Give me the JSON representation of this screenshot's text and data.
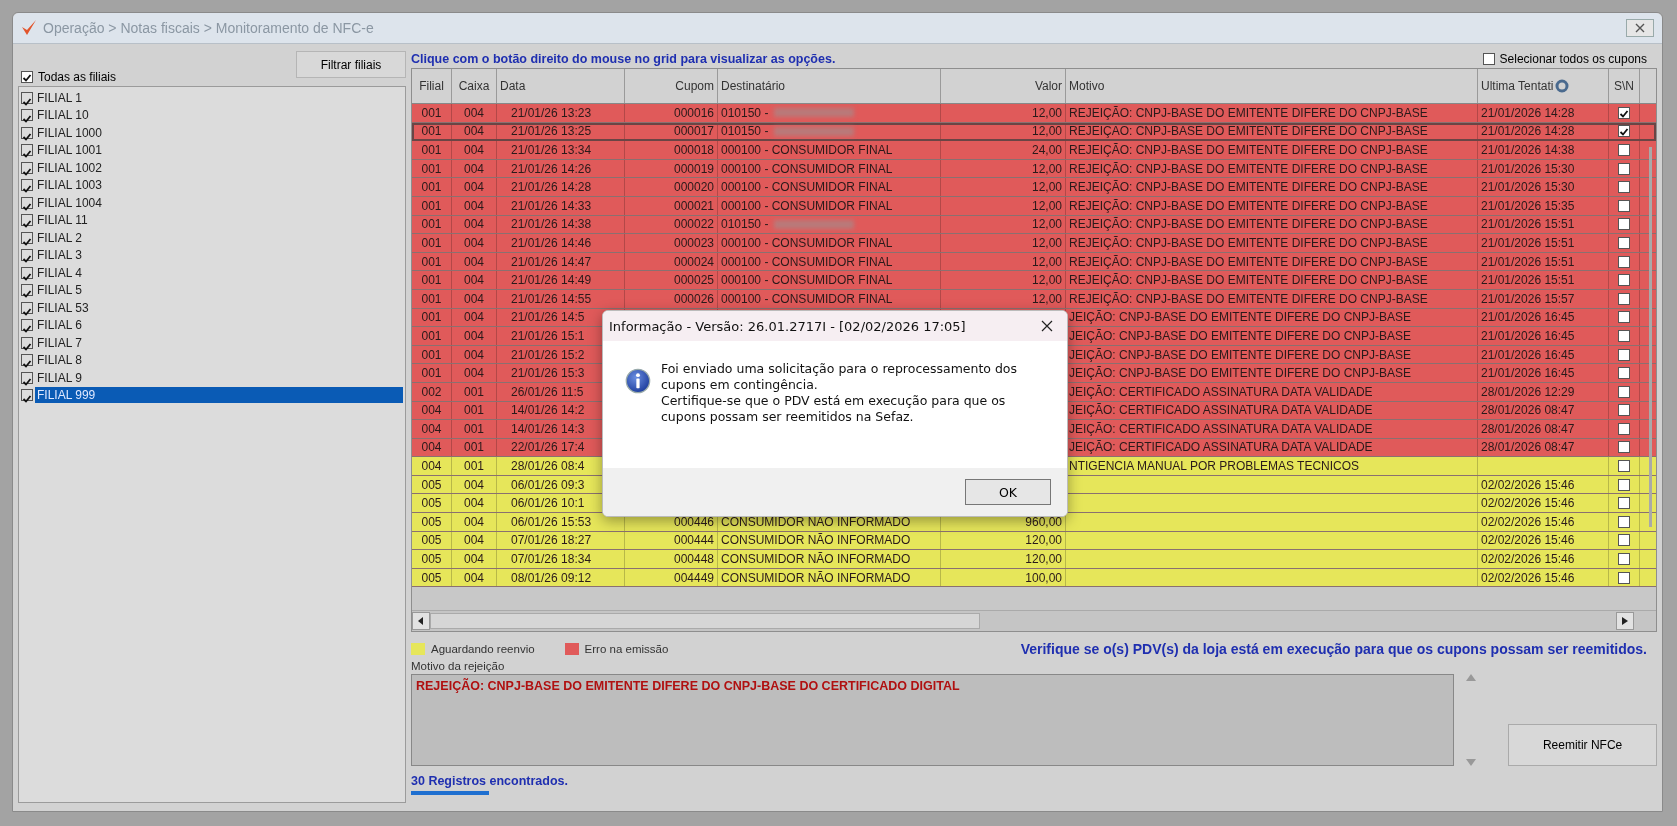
{
  "window": {
    "title": "Operação > Notas fiscais > Monitoramento de NFC-e"
  },
  "sidebar": {
    "all_branches": {
      "label": "Todas as filiais",
      "checked": true
    },
    "filter_button": "Filtrar filiais",
    "branches": [
      {
        "label": "FILIAL 1",
        "checked": true,
        "selected": false
      },
      {
        "label": "FILIAL 10",
        "checked": true,
        "selected": false
      },
      {
        "label": "FILIAL 1000",
        "checked": true,
        "selected": false
      },
      {
        "label": "FILIAL 1001",
        "checked": true,
        "selected": false
      },
      {
        "label": "FILIAL 1002",
        "checked": true,
        "selected": false
      },
      {
        "label": "FILIAL 1003",
        "checked": true,
        "selected": false
      },
      {
        "label": "FILIAL 1004",
        "checked": true,
        "selected": false
      },
      {
        "label": "FILIAL 11",
        "checked": true,
        "selected": false
      },
      {
        "label": "FILIAL 2",
        "checked": true,
        "selected": false
      },
      {
        "label": "FILIAL 3",
        "checked": true,
        "selected": false
      },
      {
        "label": "FILIAL 4",
        "checked": true,
        "selected": false
      },
      {
        "label": "FILIAL 5",
        "checked": true,
        "selected": false
      },
      {
        "label": "FILIAL 53",
        "checked": true,
        "selected": false
      },
      {
        "label": "FILIAL 6",
        "checked": true,
        "selected": false
      },
      {
        "label": "FILIAL 7",
        "checked": true,
        "selected": false
      },
      {
        "label": "FILIAL 8",
        "checked": true,
        "selected": false
      },
      {
        "label": "FILIAL 9",
        "checked": true,
        "selected": false
      },
      {
        "label": "FILIAL 999",
        "checked": true,
        "selected": true
      }
    ]
  },
  "hint": "Clique com o botão direito do mouse no grid para visualizar as opções.",
  "select_all": {
    "label": "Selecionar todos os cupons",
    "checked": false
  },
  "table": {
    "columns": [
      "Filial",
      "Caixa",
      "Data",
      "Cupom",
      "Destinatário",
      "Valor",
      "Motivo",
      "Ultima Tentati",
      "S\\N"
    ],
    "rows": [
      {
        "kind": "error",
        "selected": false,
        "checked": true,
        "redacted": true,
        "filial": "001",
        "caixa": "004",
        "data": "21/01/26 13:23",
        "cupom": "000016",
        "destinatario": "010150 -",
        "valor": "12,00",
        "motivo": "REJEIÇÃO: CNPJ-BASE DO EMITENTE DIFERE DO CNPJ-BASE",
        "ultima": "21/01/2026 14:28"
      },
      {
        "kind": "error",
        "selected": true,
        "checked": true,
        "redacted": true,
        "filial": "001",
        "caixa": "004",
        "data": "21/01/26 13:25",
        "cupom": "000017",
        "destinatario": "010150 -",
        "valor": "12,00",
        "motivo": "REJEIÇÃO: CNPJ-BASE DO EMITENTE DIFERE DO CNPJ-BASE",
        "ultima": "21/01/2026 14:28"
      },
      {
        "kind": "error",
        "selected": false,
        "checked": false,
        "redacted": false,
        "filial": "001",
        "caixa": "004",
        "data": "21/01/26 13:34",
        "cupom": "000018",
        "destinatario": "000100 - CONSUMIDOR FINAL",
        "valor": "24,00",
        "motivo": "REJEIÇÃO: CNPJ-BASE DO EMITENTE DIFERE DO CNPJ-BASE",
        "ultima": "21/01/2026 14:38"
      },
      {
        "kind": "error",
        "selected": false,
        "checked": false,
        "redacted": false,
        "filial": "001",
        "caixa": "004",
        "data": "21/01/26 14:26",
        "cupom": "000019",
        "destinatario": "000100 - CONSUMIDOR FINAL",
        "valor": "12,00",
        "motivo": "REJEIÇÃO: CNPJ-BASE DO EMITENTE DIFERE DO CNPJ-BASE",
        "ultima": "21/01/2026 15:30"
      },
      {
        "kind": "error",
        "selected": false,
        "checked": false,
        "redacted": false,
        "filial": "001",
        "caixa": "004",
        "data": "21/01/26 14:28",
        "cupom": "000020",
        "destinatario": "000100 - CONSUMIDOR FINAL",
        "valor": "12,00",
        "motivo": "REJEIÇÃO: CNPJ-BASE DO EMITENTE DIFERE DO CNPJ-BASE",
        "ultima": "21/01/2026 15:30"
      },
      {
        "kind": "error",
        "selected": false,
        "checked": false,
        "redacted": false,
        "filial": "001",
        "caixa": "004",
        "data": "21/01/26 14:33",
        "cupom": "000021",
        "destinatario": "000100 - CONSUMIDOR FINAL",
        "valor": "12,00",
        "motivo": "REJEIÇÃO: CNPJ-BASE DO EMITENTE DIFERE DO CNPJ-BASE",
        "ultima": "21/01/2026 15:35"
      },
      {
        "kind": "error",
        "selected": false,
        "checked": false,
        "redacted": true,
        "filial": "001",
        "caixa": "004",
        "data": "21/01/26 14:38",
        "cupom": "000022",
        "destinatario": "010150 -",
        "valor": "12,00",
        "motivo": "REJEIÇÃO: CNPJ-BASE DO EMITENTE DIFERE DO CNPJ-BASE",
        "ultima": "21/01/2026 15:51"
      },
      {
        "kind": "error",
        "selected": false,
        "checked": false,
        "redacted": false,
        "filial": "001",
        "caixa": "004",
        "data": "21/01/26 14:46",
        "cupom": "000023",
        "destinatario": "000100 - CONSUMIDOR FINAL",
        "valor": "12,00",
        "motivo": "REJEIÇÃO: CNPJ-BASE DO EMITENTE DIFERE DO CNPJ-BASE",
        "ultima": "21/01/2026 15:51"
      },
      {
        "kind": "error",
        "selected": false,
        "checked": false,
        "redacted": false,
        "filial": "001",
        "caixa": "004",
        "data": "21/01/26 14:47",
        "cupom": "000024",
        "destinatario": "000100 - CONSUMIDOR FINAL",
        "valor": "12,00",
        "motivo": "REJEIÇÃO: CNPJ-BASE DO EMITENTE DIFERE DO CNPJ-BASE",
        "ultima": "21/01/2026 15:51"
      },
      {
        "kind": "error",
        "selected": false,
        "checked": false,
        "redacted": false,
        "filial": "001",
        "caixa": "004",
        "data": "21/01/26 14:49",
        "cupom": "000025",
        "destinatario": "000100 - CONSUMIDOR FINAL",
        "valor": "12,00",
        "motivo": "REJEIÇÃO: CNPJ-BASE DO EMITENTE DIFERE DO CNPJ-BASE",
        "ultima": "21/01/2026 15:51"
      },
      {
        "kind": "error",
        "selected": false,
        "checked": false,
        "redacted": false,
        "filial": "001",
        "caixa": "004",
        "data": "21/01/26 14:55",
        "cupom": "000026",
        "destinatario": "000100 - CONSUMIDOR FINAL",
        "valor": "12,00",
        "motivo": "REJEIÇÃO: CNPJ-BASE DO EMITENTE DIFERE DO CNPJ-BASE",
        "ultima": "21/01/2026 15:57"
      },
      {
        "kind": "error",
        "selected": false,
        "checked": false,
        "filial": "001",
        "caixa": "004",
        "data": "21/01/26 14:5",
        "motivo": "JEIÇÃO: CNPJ-BASE DO EMITENTE DIFERE DO CNPJ-BASE",
        "ultima": "21/01/2026 16:45"
      },
      {
        "kind": "error",
        "selected": false,
        "checked": false,
        "filial": "001",
        "caixa": "004",
        "data": "21/01/26 15:1",
        "motivo": "JEIÇÃO: CNPJ-BASE DO EMITENTE DIFERE DO CNPJ-BASE",
        "ultima": "21/01/2026 16:45"
      },
      {
        "kind": "error",
        "selected": false,
        "checked": false,
        "filial": "001",
        "caixa": "004",
        "data": "21/01/26 15:2",
        "motivo": "JEIÇÃO: CNPJ-BASE DO EMITENTE DIFERE DO CNPJ-BASE",
        "ultima": "21/01/2026 16:45"
      },
      {
        "kind": "error",
        "selected": false,
        "checked": false,
        "filial": "001",
        "caixa": "004",
        "data": "21/01/26 15:3",
        "motivo": "JEIÇÃO: CNPJ-BASE DO EMITENTE DIFERE DO CNPJ-BASE",
        "ultima": "21/01/2026 16:45"
      },
      {
        "kind": "error",
        "selected": false,
        "checked": false,
        "filial": "002",
        "caixa": "001",
        "data": "26/01/26 11:5",
        "motivo": "JEIÇÃO: CERTIFICADO ASSINATURA DATA VALIDADE",
        "ultima": "28/01/2026 12:29"
      },
      {
        "kind": "error",
        "selected": false,
        "checked": false,
        "filial": "004",
        "caixa": "001",
        "data": "14/01/26 14:2",
        "motivo": "JEIÇÃO: CERTIFICADO ASSINATURA DATA VALIDADE",
        "ultima": "28/01/2026 08:47"
      },
      {
        "kind": "error",
        "selected": false,
        "checked": false,
        "filial": "004",
        "caixa": "001",
        "data": "14/01/26 14:3",
        "motivo": "JEIÇÃO: CERTIFICADO ASSINATURA DATA VALIDADE",
        "ultima": "28/01/2026 08:47"
      },
      {
        "kind": "error",
        "selected": false,
        "checked": false,
        "filial": "004",
        "caixa": "001",
        "data": "22/01/26 17:4",
        "motivo": "JEIÇÃO: CERTIFICADO ASSINATURA DATA VALIDADE",
        "ultima": "28/01/2026 08:47"
      },
      {
        "kind": "waiting",
        "selected": false,
        "checked": false,
        "filial": "004",
        "caixa": "001",
        "data": "28/01/26 08:4",
        "motivo": "NTIGENCIA MANUAL POR PROBLEMAS TECNICOS"
      },
      {
        "kind": "waiting",
        "selected": false,
        "checked": false,
        "filial": "005",
        "caixa": "004",
        "data": "06/01/26 09:3",
        "ultima": "02/02/2026 15:46"
      },
      {
        "kind": "waiting",
        "selected": false,
        "checked": false,
        "filial": "005",
        "caixa": "004",
        "data": "06/01/26 10:1",
        "ultima": "02/02/2026 15:46"
      },
      {
        "kind": "waiting",
        "selected": false,
        "checked": false,
        "redacted": false,
        "filial": "005",
        "caixa": "004",
        "data": "06/01/26 15:53",
        "cupom": "000446",
        "destinatario": "CONSUMIDOR NÃO INFORMADO",
        "valor": "960,00",
        "ultima": "02/02/2026 15:46"
      },
      {
        "kind": "waiting",
        "selected": false,
        "checked": false,
        "redacted": false,
        "filial": "005",
        "caixa": "004",
        "data": "07/01/26 18:27",
        "cupom": "000444",
        "destinatario": "CONSUMIDOR NÃO INFORMADO",
        "valor": "120,00",
        "ultima": "02/02/2026 15:46"
      },
      {
        "kind": "waiting",
        "selected": false,
        "checked": false,
        "redacted": false,
        "filial": "005",
        "caixa": "004",
        "data": "07/01/26 18:34",
        "cupom": "000448",
        "destinatario": "CONSUMIDOR NÃO INFORMADO",
        "valor": "120,00",
        "ultima": "02/02/2026 15:46"
      },
      {
        "kind": "waiting",
        "selected": false,
        "checked": false,
        "redacted": false,
        "filial": "005",
        "caixa": "004",
        "data": "08/01/26 09:12",
        "cupom": "004449",
        "destinatario": "CONSUMIDOR NÃO INFORMADO",
        "valor": "100,00",
        "ultima": "02/02/2026 15:46"
      }
    ]
  },
  "legend": [
    {
      "kind": "waiting",
      "label": "Aguardando reenvio",
      "color": "#e6e65a"
    },
    {
      "kind": "error",
      "label": "Erro na emissão",
      "color": "#e05a5a"
    }
  ],
  "notice": "Verifique se o(s) PDV(s) da loja está em execução para que os cupons possam ser reemitidos.",
  "rejection": {
    "label": "Motivo da rejeição",
    "value": "REJEIÇÃO: CNPJ-BASE DO EMITENTE DIFERE DO CNPJ-BASE DO CERTIFICADO DIGITAL"
  },
  "reissue_button": "Reemitir NFCe",
  "status": "30 Registros encontrados.",
  "dialog": {
    "title": "Informação - Versão: 26.01.2717I - [02/02/2026 17:05]",
    "paragraphs": [
      "Foi enviado uma solicitação para o reprocessamento dos cupons em contingência.",
      "Certifique-se que o PDV está em execução para que os cupons possam ser reemitidos na Sefaz."
    ],
    "button": "OK"
  }
}
